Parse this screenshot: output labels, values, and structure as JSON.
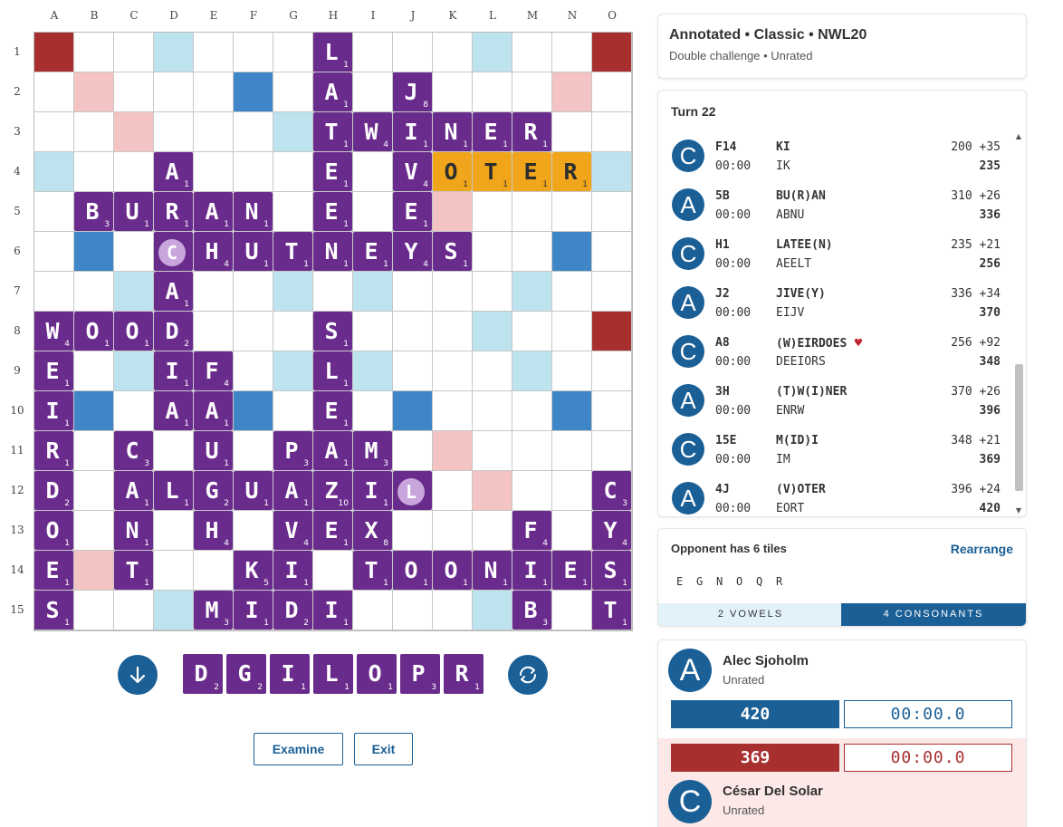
{
  "board": {
    "columns": [
      "A",
      "B",
      "C",
      "D",
      "E",
      "F",
      "G",
      "H",
      "I",
      "J",
      "K",
      "L",
      "M",
      "N",
      "O"
    ],
    "rows": [
      "1",
      "2",
      "3",
      "4",
      "5",
      "6",
      "7",
      "8",
      "9",
      "10",
      "11",
      "12",
      "13",
      "14",
      "15"
    ],
    "tiles": [
      {
        "r": 0,
        "c": 7,
        "l": "L",
        "p": "1"
      },
      {
        "r": 1,
        "c": 7,
        "l": "A",
        "p": "1"
      },
      {
        "r": 1,
        "c": 9,
        "l": "J",
        "p": "8"
      },
      {
        "r": 2,
        "c": 7,
        "l": "T",
        "p": "1"
      },
      {
        "r": 2,
        "c": 8,
        "l": "W",
        "p": "4"
      },
      {
        "r": 2,
        "c": 9,
        "l": "I",
        "p": "1"
      },
      {
        "r": 2,
        "c": 10,
        "l": "N",
        "p": "1"
      },
      {
        "r": 2,
        "c": 11,
        "l": "E",
        "p": "1"
      },
      {
        "r": 2,
        "c": 12,
        "l": "R",
        "p": "1"
      },
      {
        "r": 3,
        "c": 3,
        "l": "A",
        "p": "1"
      },
      {
        "r": 3,
        "c": 7,
        "l": "E",
        "p": "1"
      },
      {
        "r": 3,
        "c": 9,
        "l": "V",
        "p": "4"
      },
      {
        "r": 3,
        "c": 10,
        "l": "O",
        "p": "1",
        "last": true
      },
      {
        "r": 3,
        "c": 11,
        "l": "T",
        "p": "1",
        "last": true
      },
      {
        "r": 3,
        "c": 12,
        "l": "E",
        "p": "1",
        "last": true
      },
      {
        "r": 3,
        "c": 13,
        "l": "R",
        "p": "1",
        "last": true
      },
      {
        "r": 4,
        "c": 1,
        "l": "B",
        "p": "3"
      },
      {
        "r": 4,
        "c": 2,
        "l": "U",
        "p": "1"
      },
      {
        "r": 4,
        "c": 3,
        "l": "R",
        "p": "1"
      },
      {
        "r": 4,
        "c": 4,
        "l": "A",
        "p": "1"
      },
      {
        "r": 4,
        "c": 5,
        "l": "N",
        "p": "1"
      },
      {
        "r": 4,
        "c": 7,
        "l": "E",
        "p": "1"
      },
      {
        "r": 4,
        "c": 9,
        "l": "E",
        "p": "1"
      },
      {
        "r": 5,
        "c": 3,
        "l": "C",
        "p": "",
        "blank": true
      },
      {
        "r": 5,
        "c": 4,
        "l": "H",
        "p": "4"
      },
      {
        "r": 5,
        "c": 5,
        "l": "U",
        "p": "1"
      },
      {
        "r": 5,
        "c": 6,
        "l": "T",
        "p": "1"
      },
      {
        "r": 5,
        "c": 7,
        "l": "N",
        "p": "1"
      },
      {
        "r": 5,
        "c": 8,
        "l": "E",
        "p": "1"
      },
      {
        "r": 5,
        "c": 9,
        "l": "Y",
        "p": "4"
      },
      {
        "r": 5,
        "c": 10,
        "l": "S",
        "p": "1"
      },
      {
        "r": 6,
        "c": 3,
        "l": "A",
        "p": "1"
      },
      {
        "r": 7,
        "c": 0,
        "l": "W",
        "p": "4"
      },
      {
        "r": 7,
        "c": 1,
        "l": "O",
        "p": "1"
      },
      {
        "r": 7,
        "c": 2,
        "l": "O",
        "p": "1"
      },
      {
        "r": 7,
        "c": 3,
        "l": "D",
        "p": "2"
      },
      {
        "r": 7,
        "c": 7,
        "l": "S",
        "p": "1"
      },
      {
        "r": 8,
        "c": 0,
        "l": "E",
        "p": "1"
      },
      {
        "r": 8,
        "c": 3,
        "l": "I",
        "p": "1"
      },
      {
        "r": 8,
        "c": 4,
        "l": "F",
        "p": "4"
      },
      {
        "r": 8,
        "c": 7,
        "l": "L",
        "p": "1"
      },
      {
        "r": 9,
        "c": 0,
        "l": "I",
        "p": "1"
      },
      {
        "r": 9,
        "c": 3,
        "l": "A",
        "p": "1"
      },
      {
        "r": 9,
        "c": 4,
        "l": "A",
        "p": "1"
      },
      {
        "r": 9,
        "c": 7,
        "l": "E",
        "p": "1"
      },
      {
        "r": 10,
        "c": 0,
        "l": "R",
        "p": "1"
      },
      {
        "r": 10,
        "c": 2,
        "l": "C",
        "p": "3"
      },
      {
        "r": 10,
        "c": 4,
        "l": "U",
        "p": "1"
      },
      {
        "r": 10,
        "c": 6,
        "l": "P",
        "p": "3"
      },
      {
        "r": 10,
        "c": 7,
        "l": "A",
        "p": "1"
      },
      {
        "r": 10,
        "c": 8,
        "l": "M",
        "p": "3"
      },
      {
        "r": 11,
        "c": 0,
        "l": "D",
        "p": "2"
      },
      {
        "r": 11,
        "c": 2,
        "l": "A",
        "p": "1"
      },
      {
        "r": 11,
        "c": 3,
        "l": "L",
        "p": "1"
      },
      {
        "r": 11,
        "c": 4,
        "l": "G",
        "p": "2"
      },
      {
        "r": 11,
        "c": 5,
        "l": "U",
        "p": "1"
      },
      {
        "r": 11,
        "c": 6,
        "l": "A",
        "p": "1"
      },
      {
        "r": 11,
        "c": 7,
        "l": "Z",
        "p": "10"
      },
      {
        "r": 11,
        "c": 8,
        "l": "I",
        "p": "1"
      },
      {
        "r": 11,
        "c": 9,
        "l": "L",
        "p": "",
        "blank": true
      },
      {
        "r": 11,
        "c": 14,
        "l": "C",
        "p": "3"
      },
      {
        "r": 12,
        "c": 0,
        "l": "O",
        "p": "1"
      },
      {
        "r": 12,
        "c": 2,
        "l": "N",
        "p": "1"
      },
      {
        "r": 12,
        "c": 4,
        "l": "H",
        "p": "4"
      },
      {
        "r": 12,
        "c": 6,
        "l": "V",
        "p": "4"
      },
      {
        "r": 12,
        "c": 7,
        "l": "E",
        "p": "1"
      },
      {
        "r": 12,
        "c": 8,
        "l": "X",
        "p": "8"
      },
      {
        "r": 12,
        "c": 12,
        "l": "F",
        "p": "4"
      },
      {
        "r": 12,
        "c": 14,
        "l": "Y",
        "p": "4"
      },
      {
        "r": 13,
        "c": 0,
        "l": "E",
        "p": "1"
      },
      {
        "r": 13,
        "c": 2,
        "l": "T",
        "p": "1"
      },
      {
        "r": 13,
        "c": 5,
        "l": "K",
        "p": "5"
      },
      {
        "r": 13,
        "c": 6,
        "l": "I",
        "p": "1"
      },
      {
        "r": 13,
        "c": 8,
        "l": "T",
        "p": "1"
      },
      {
        "r": 13,
        "c": 9,
        "l": "O",
        "p": "1"
      },
      {
        "r": 13,
        "c": 10,
        "l": "O",
        "p": "1"
      },
      {
        "r": 13,
        "c": 11,
        "l": "N",
        "p": "1"
      },
      {
        "r": 13,
        "c": 12,
        "l": "I",
        "p": "1"
      },
      {
        "r": 13,
        "c": 13,
        "l": "E",
        "p": "1"
      },
      {
        "r": 13,
        "c": 14,
        "l": "S",
        "p": "1"
      },
      {
        "r": 14,
        "c": 0,
        "l": "S",
        "p": "1"
      },
      {
        "r": 14,
        "c": 4,
        "l": "M",
        "p": "3"
      },
      {
        "r": 14,
        "c": 5,
        "l": "I",
        "p": "1"
      },
      {
        "r": 14,
        "c": 6,
        "l": "D",
        "p": "2"
      },
      {
        "r": 14,
        "c": 7,
        "l": "I",
        "p": "1"
      },
      {
        "r": 14,
        "c": 12,
        "l": "B",
        "p": "3"
      },
      {
        "r": 14,
        "c": 14,
        "l": "T",
        "p": "1"
      }
    ],
    "colors": {
      "tile": "#6a2c8c",
      "last_move": "#f0a51a",
      "triple_word": "#a7302f",
      "double_word": "#f4c3c3",
      "triple_letter": "#3e86c8",
      "double_letter": "#bde3ef"
    }
  },
  "rack": {
    "tiles": [
      {
        "l": "D",
        "p": "2"
      },
      {
        "l": "G",
        "p": "2"
      },
      {
        "l": "I",
        "p": "1"
      },
      {
        "l": "L",
        "p": "1"
      },
      {
        "l": "O",
        "p": "1"
      },
      {
        "l": "P",
        "p": "3"
      },
      {
        "l": "R",
        "p": "1"
      }
    ],
    "left_icon": "arrow-down-icon",
    "right_icon": "shuffle-icon"
  },
  "buttons": {
    "examine": "Examine",
    "exit": "Exit"
  },
  "game_info": {
    "title": "Annotated • Classic • NWL20",
    "subtitle": "Double challenge • Unrated"
  },
  "turns": {
    "header": "Turn 22",
    "list": [
      {
        "player": "C",
        "coord": "F14",
        "time": "00:00",
        "word": "KI",
        "rack": "IK",
        "prev": "200",
        "delta": "+35",
        "total": "235",
        "heart": false
      },
      {
        "player": "A",
        "coord": "5B",
        "time": "00:00",
        "word": "BU(R)AN",
        "rack": "ABNU",
        "prev": "310",
        "delta": "+26",
        "total": "336",
        "heart": false
      },
      {
        "player": "C",
        "coord": "H1",
        "time": "00:00",
        "word": "LATEE(N)",
        "rack": "AEELT",
        "prev": "235",
        "delta": "+21",
        "total": "256",
        "heart": false
      },
      {
        "player": "A",
        "coord": "J2",
        "time": "00:00",
        "word": "JIVE(Y)",
        "rack": "EIJV",
        "prev": "336",
        "delta": "+34",
        "total": "370",
        "heart": false
      },
      {
        "player": "C",
        "coord": "A8",
        "time": "00:00",
        "word": "(W)EIRDOES",
        "rack": "DEEIORS",
        "prev": "256",
        "delta": "+92",
        "total": "348",
        "heart": true
      },
      {
        "player": "A",
        "coord": "3H",
        "time": "00:00",
        "word": "(T)W(I)NER",
        "rack": "ENRW",
        "prev": "370",
        "delta": "+26",
        "total": "396",
        "heart": false
      },
      {
        "player": "C",
        "coord": "15E",
        "time": "00:00",
        "word": "M(ID)I",
        "rack": "IM",
        "prev": "348",
        "delta": "+21",
        "total": "369",
        "heart": false
      },
      {
        "player": "A",
        "coord": "4J",
        "time": "00:00",
        "word": "(V)OTER",
        "rack": "EORT",
        "prev": "396",
        "delta": "+24",
        "total": "420",
        "heart": false
      }
    ]
  },
  "opponent": {
    "title": "Opponent has 6 tiles",
    "rearrange": "Rearrange",
    "tiles": [
      "E",
      "G",
      "N",
      "O",
      "Q",
      "R"
    ],
    "vowels_label": "2 VOWELS",
    "consonants_label": "4 CONSONANTS"
  },
  "players": [
    {
      "initial": "A",
      "name": "Alec Sjoholm",
      "rating": "Unrated",
      "score": "420",
      "clock": "00:00.0",
      "color": "#1a5f96"
    },
    {
      "initial": "C",
      "name": "César Del Solar",
      "rating": "Unrated",
      "score": "369",
      "clock": "00:00.0",
      "color": "#a7302f"
    }
  ]
}
